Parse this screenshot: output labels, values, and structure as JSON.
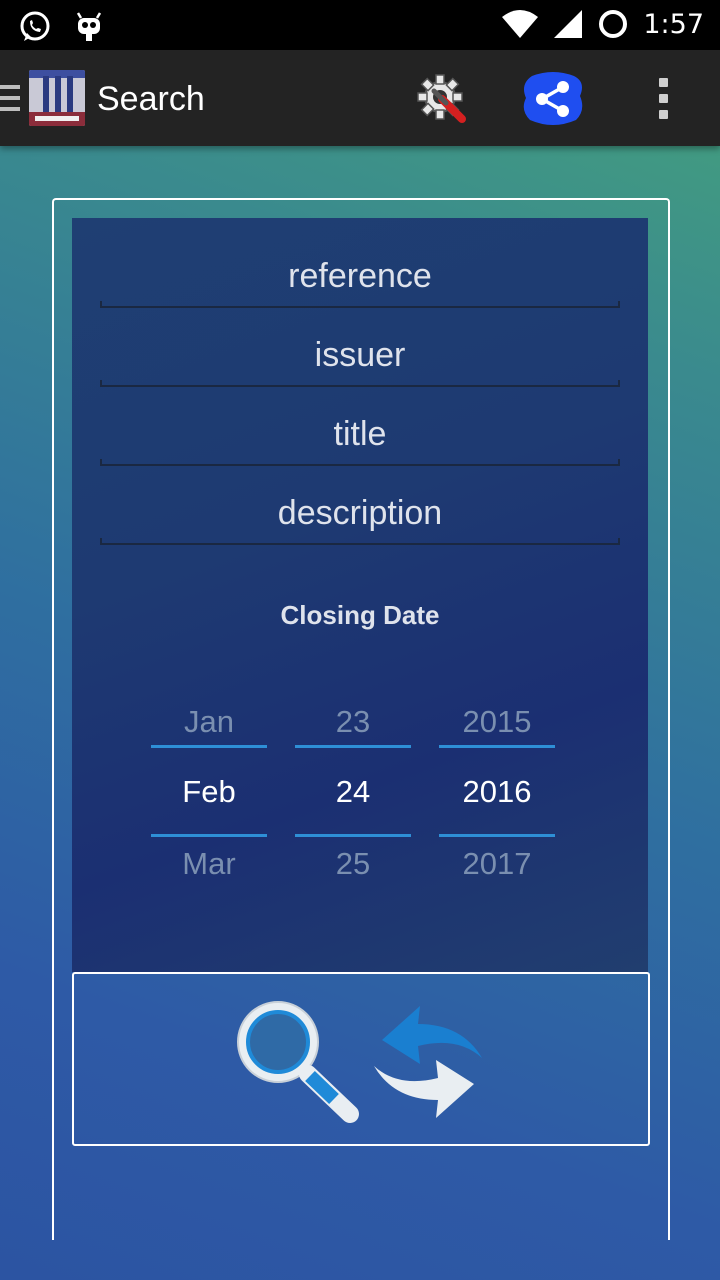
{
  "status_bar": {
    "time": "1:57",
    "icons": [
      "whatsapp-icon",
      "android-debug-icon",
      "wifi-icon",
      "signal-icon",
      "battery-ring-icon"
    ]
  },
  "action_bar": {
    "title": "Search",
    "actions": [
      "settings-wrench-icon",
      "share-icon",
      "overflow-menu-icon"
    ]
  },
  "form": {
    "fields": [
      {
        "placeholder": "reference",
        "value": ""
      },
      {
        "placeholder": "issuer",
        "value": ""
      },
      {
        "placeholder": "title",
        "value": ""
      },
      {
        "placeholder": "description",
        "value": ""
      }
    ],
    "closing_date_label": "Closing Date",
    "date_picker": {
      "month": {
        "prev": "Jan",
        "current": "Feb",
        "next": "Mar"
      },
      "day": {
        "prev": "23",
        "current": "24",
        "next": "25"
      },
      "year": {
        "prev": "2015",
        "current": "2016",
        "next": "2017"
      }
    }
  },
  "buttons": [
    "search-icon",
    "refresh-icon"
  ],
  "colors": {
    "accent": "#2e8fd6",
    "share_bg": "#1f4ef0",
    "panel": "#1e3a72"
  }
}
